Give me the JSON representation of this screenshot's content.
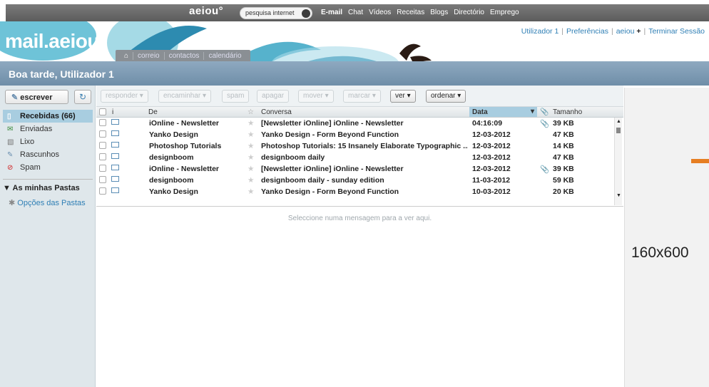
{
  "portal": {
    "logo": "aeiou°",
    "search_placeholder": "pesquisa internet",
    "links": [
      "E-mail",
      "Chat",
      "Vídeos",
      "Receitas",
      "Blogs",
      "Directório",
      "Emprego"
    ]
  },
  "header": {
    "brand": "mail.aeiou",
    "tabs": [
      "correio",
      "contactos",
      "calendário"
    ],
    "user_links": [
      "Utilizador 1",
      "Preferências",
      "aeiou",
      "Terminar Sessão"
    ],
    "greeting": "Boa tarde, Utilizador 1"
  },
  "sidebar": {
    "write_label": "escrever",
    "folders": [
      {
        "label": "Recebidas (66)",
        "icon": "inbox-icon"
      },
      {
        "label": "Enviadas",
        "icon": "sent-icon"
      },
      {
        "label": "Lixo",
        "icon": "trash-icon"
      },
      {
        "label": "Rascunhos",
        "icon": "drafts-icon"
      },
      {
        "label": "Spam",
        "icon": "spam-icon"
      }
    ],
    "my_folders": "As minhas Pastas",
    "folder_options": "Opções das Pastas"
  },
  "toolbar": {
    "reply": "responder",
    "forward": "encaminhar",
    "spam": "spam",
    "delete": "apagar",
    "move": "mover",
    "mark": "marcar",
    "view": "ver",
    "sort": "ordenar"
  },
  "list": {
    "columns": {
      "info": "i",
      "from": "De",
      "conversation": "Conversa",
      "date": "Data",
      "size": "Tamanho"
    },
    "rows": [
      {
        "from": "iOnline - Newsletter",
        "subject": "[Newsletter iOnline] iOnline - Newsletter",
        "date": "04:16:09",
        "size": "39 KB",
        "attachment": true
      },
      {
        "from": "Yanko Design",
        "subject": "Yanko Design - Form Beyond Function",
        "date": "12-03-2012",
        "size": "47 KB",
        "attachment": false
      },
      {
        "from": "Photoshop Tutorials",
        "subject": "Photoshop Tutorials: 15 Insanely Elaborate Typographic ...",
        "date": "12-03-2012",
        "size": "14 KB",
        "attachment": false
      },
      {
        "from": "designboom",
        "subject": "designboom daily",
        "date": "12-03-2012",
        "size": "47 KB",
        "attachment": false
      },
      {
        "from": "iOnline - Newsletter",
        "subject": "[Newsletter iOnline] iOnline - Newsletter",
        "date": "12-03-2012",
        "size": "39 KB",
        "attachment": true
      },
      {
        "from": "designboom",
        "subject": "designboom daily - sunday edition",
        "date": "11-03-2012",
        "size": "59 KB",
        "attachment": false
      },
      {
        "from": "Yanko Design",
        "subject": "Yanko Design - Form Beyond Function",
        "date": "10-03-2012",
        "size": "20 KB",
        "attachment": false
      }
    ]
  },
  "preview": {
    "message": "Seleccione numa mensagem para a ver aqui."
  },
  "ad": {
    "size_label": "160x600"
  }
}
